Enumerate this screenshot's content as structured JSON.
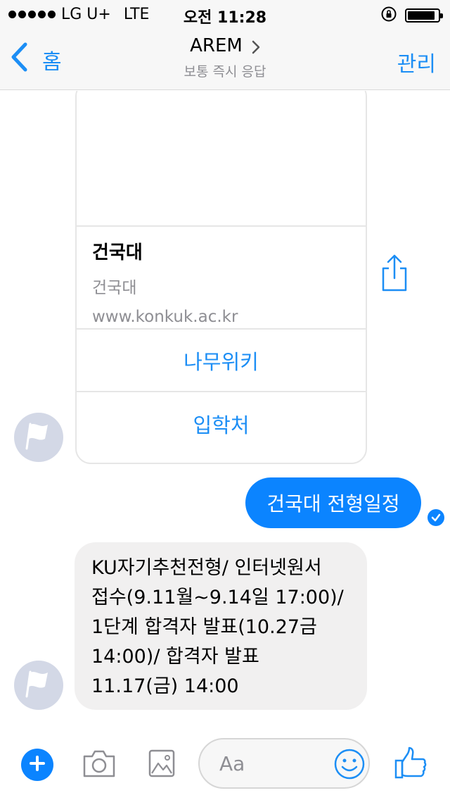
{
  "status_bar": {
    "carrier": "LG U+",
    "network": "LTE",
    "time": "오전 11:28"
  },
  "nav": {
    "back_label": "홈",
    "title": "AREM",
    "subtitle": "보통 즉시 응답",
    "manage_label": "관리"
  },
  "card": {
    "title": "건국대",
    "subtitle": "건국대",
    "url": "www.konkuk.ac.kr",
    "buttons": [
      "나무위키",
      "입학처"
    ]
  },
  "messages": {
    "outgoing": "건국대 전형일정",
    "incoming_lines": [
      "KU자기추천전형/ 인터넷원서",
      "접수(9.11월~9.14일 17:00)/",
      "1단계 합격자 발표(10.27금",
      "14:00)/ 합격자 발표",
      "11.17(금) 14:00"
    ]
  },
  "composer": {
    "placeholder": "Aa"
  },
  "icons": {
    "back": "chevron-left-icon",
    "title_chevron": "chevron-right-icon",
    "share": "share-icon",
    "avatar": "flag-icon",
    "read": "check-icon",
    "add": "plus-icon",
    "camera": "camera-icon",
    "gallery": "image-icon",
    "emoji": "smiley-icon",
    "like": "thumbs-up-icon"
  },
  "colors": {
    "accent": "#1c8ef5",
    "outgoing_bubble": "#0b84ff",
    "incoming_bubble": "#f1f0f0",
    "avatar_bg": "#d3d8e6"
  }
}
